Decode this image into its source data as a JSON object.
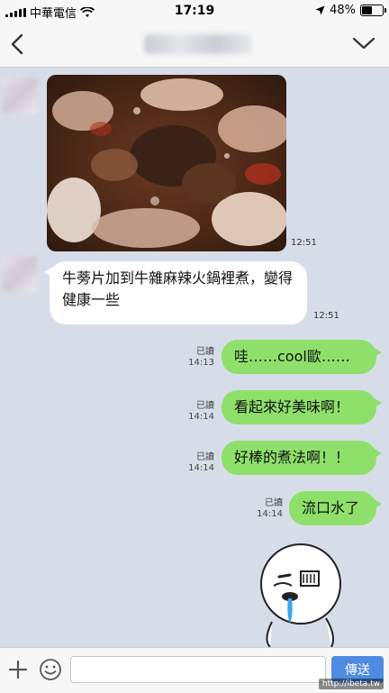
{
  "status_bar": {
    "carrier": "中華電信",
    "time": "17:19",
    "battery_text": "48%",
    "battery_level": 0.48
  },
  "header": {
    "back_icon": "chevron-left-icon",
    "menu_icon": "chevron-down-icon"
  },
  "messages": {
    "photo_time": "12:51",
    "incoming_text": "牛蒡片加到牛雜麻辣火鍋裡煮，變得健康一些",
    "incoming_time": "12:51",
    "outgoing": [
      {
        "text": "哇……cool歐……",
        "read": "已讀",
        "time": "14:13"
      },
      {
        "text": "看起來好美味啊！",
        "read": "已讀",
        "time": "14:14"
      },
      {
        "text": "好棒的煮法啊！！",
        "read": "已讀",
        "time": "14:14"
      },
      {
        "text": "流口水了",
        "read": "已讀",
        "time": "14:14"
      }
    ]
  },
  "input_bar": {
    "placeholder": "",
    "send_label": "傳送"
  },
  "watermark": "http://ibeta.tw",
  "colors": {
    "chat_bg": "#d7dde8",
    "outgoing_bubble": "#8ee06a",
    "incoming_bubble": "#ffffff",
    "send_button": "#4f8be0"
  }
}
